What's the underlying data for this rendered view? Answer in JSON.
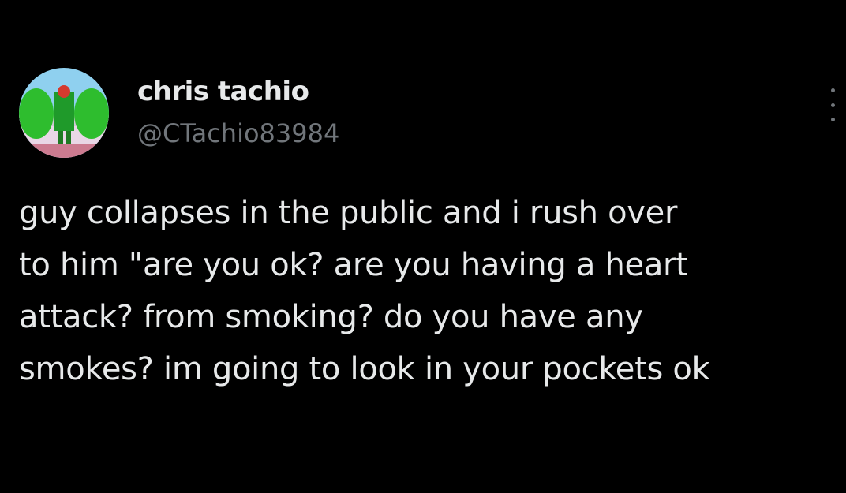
{
  "author": {
    "display_name": "chris tachio",
    "handle": "@CTachio83984",
    "avatar_icon": "cartoon-character-avatar"
  },
  "tweet": {
    "text": "guy collapses in the public and i rush over\nto him \"are you ok? are you having a heart\nattack? from smoking? do you have any\nsmokes? im going to look in your pockets ok"
  },
  "actions": {
    "more_icon": "more-options-icon"
  },
  "colors": {
    "background": "#000000",
    "primary_text": "#e7e9ea",
    "secondary_text": "#71767b"
  }
}
